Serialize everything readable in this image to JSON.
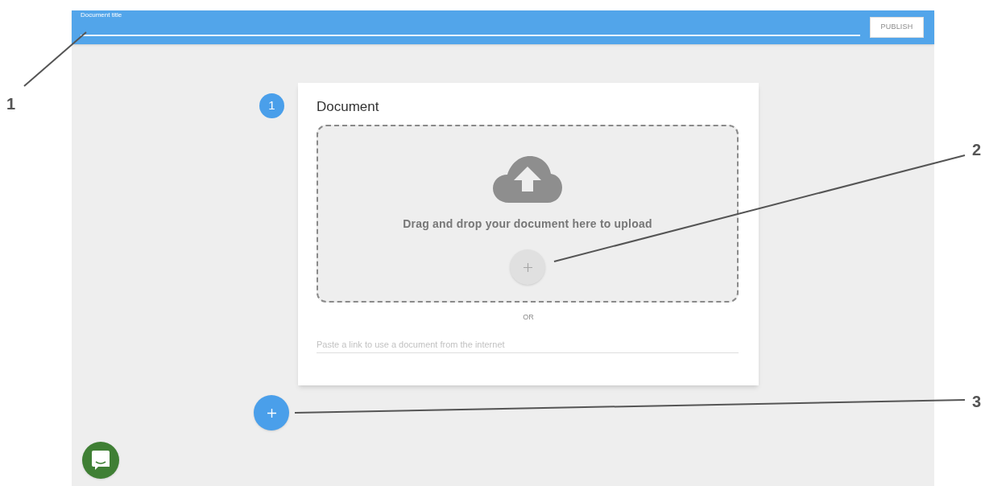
{
  "header": {
    "title_label": "Document title",
    "publish_button": "PUBLISH"
  },
  "step": {
    "number": "1",
    "title": "Document",
    "dropzone_text": "Drag and drop your document here to upload",
    "separator": "OR",
    "link_field": {
      "placeholder": "Paste a link to use a document from the internet"
    }
  },
  "callouts": [
    {
      "label": "1"
    },
    {
      "label": "2"
    },
    {
      "label": "3"
    }
  ]
}
